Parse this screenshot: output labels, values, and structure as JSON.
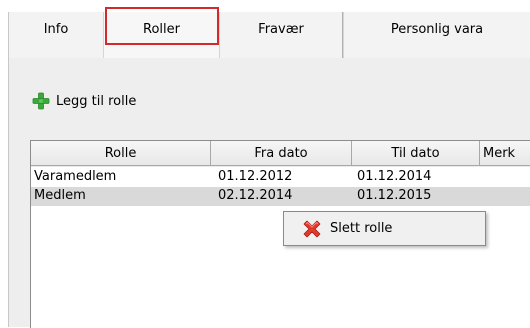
{
  "tabs": [
    {
      "label": "Info"
    },
    {
      "label": "Roller"
    },
    {
      "label": "Fravær"
    },
    {
      "label": "Personlig vara"
    }
  ],
  "selected_tab": "Roller",
  "toolbar": {
    "add_role_label": "Legg til rolle",
    "add_icon": "plus-icon"
  },
  "grid": {
    "columns": [
      "Rolle",
      "Fra dato",
      "Til dato",
      "Merk"
    ],
    "rows": [
      {
        "rolle": "Varamedlem",
        "fra": "01.12.2012",
        "til": "01.12.2014"
      },
      {
        "rolle": "Medlem",
        "fra": "02.12.2014",
        "til": "01.12.2015"
      }
    ]
  },
  "context_menu": {
    "items": [
      {
        "label": "Slett rolle",
        "icon": "delete-x-icon"
      }
    ]
  },
  "colors": {
    "highlight_border": "#d22a2a",
    "plus_icon": "#3aa83a",
    "delete_icon": "#e23a2a",
    "selected_row": "#d9d9d9"
  }
}
